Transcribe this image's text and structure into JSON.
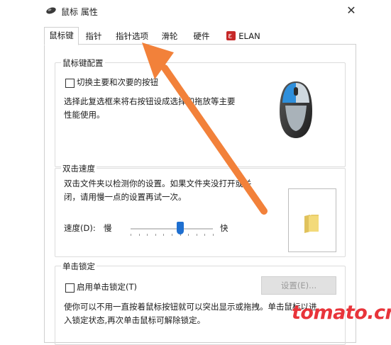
{
  "window": {
    "title": "鼠标 属性",
    "close_label": "✕"
  },
  "tabs": [
    {
      "label": "鼠标键",
      "active": true
    },
    {
      "label": "指针",
      "active": false
    },
    {
      "label": "指针选项",
      "active": false
    },
    {
      "label": "滑轮",
      "active": false
    },
    {
      "label": "硬件",
      "active": false
    },
    {
      "label": "ELAN",
      "active": false,
      "icon": "elan-icon"
    }
  ],
  "button_config": {
    "title": "鼠标键配置",
    "checkbox_label": "切换主要和次要的按钮",
    "checkbox_checked": false,
    "description_line1": "选择此复选框来将右按钮设成选择和拖放等主要",
    "description_line2": "性能使用。"
  },
  "double_click": {
    "title": "双击速度",
    "description_line1": "双击文件夹以检测你的设置。如果文件夹没打开或关",
    "description_line2": "闭，请用慢一点的设置再试一次。",
    "speed_label": "速度(D):",
    "slow_label": "慢",
    "fast_label": "快",
    "speed_value": 0.6
  },
  "click_lock": {
    "title": "单击锁定",
    "checkbox_label": "启用单击锁定(T)",
    "checkbox_checked": false,
    "settings_button": "设置(E)...",
    "description_line1": "使你可以不用一直按着鼠标按钮就可以突出显示或拖拽。单击鼠标以进",
    "description_line2": "入锁定状态,再次单击鼠标可解除锁定。"
  },
  "watermark": "tomato.cm",
  "colors": {
    "arrow": "#f2813a",
    "mouse_accent": "#2e8fdc",
    "watermark": "#e8343a"
  }
}
